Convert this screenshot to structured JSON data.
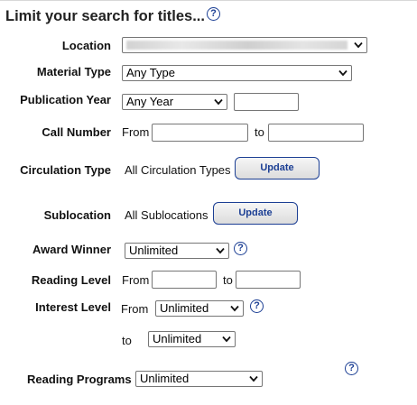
{
  "header": {
    "title": "Limit your search for titles..."
  },
  "location": {
    "label": "Location",
    "value": ""
  },
  "material_type": {
    "label": "Material Type",
    "value": "Any Type"
  },
  "publication_year": {
    "label": "Publication Year",
    "value": "Any Year",
    "year_value": ""
  },
  "call_number": {
    "label": "Call Number",
    "from_label": "From",
    "to_label": "to",
    "from_value": "",
    "to_value": ""
  },
  "circulation_type": {
    "label": "Circulation Type",
    "value": "All Circulation Types",
    "button_label": "Update"
  },
  "sublocation": {
    "label": "Sublocation",
    "value": "All Sublocations",
    "button_label": "Update"
  },
  "award_winner": {
    "label": "Award Winner",
    "value": "Unlimited"
  },
  "reading_level": {
    "label": "Reading Level",
    "from_label": "From",
    "to_label": "to",
    "from_value": "",
    "to_value": ""
  },
  "interest_level": {
    "label": "Interest Level",
    "from_label": "From",
    "from_value": "Unlimited",
    "to_label": "to",
    "to_value": "Unlimited"
  },
  "reading_programs": {
    "label": "Reading Programs",
    "value": "Unlimited"
  },
  "icons": {
    "help": "help-question-icon",
    "dropdown": "chevron-down-icon"
  },
  "colors": {
    "accent": "#1c3f94",
    "border": "#767676"
  }
}
